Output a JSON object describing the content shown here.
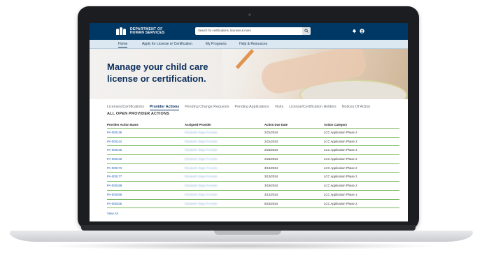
{
  "header": {
    "agency_line1": "DEPARTMENT OF",
    "agency_line2": "HUMAN SERVICES",
    "search_placeholder": "Search for certifications, licenses & more",
    "icons": [
      "search-icon",
      "bell-icon",
      "user-icon"
    ]
  },
  "nav": {
    "items": [
      "Home",
      "Apply for License or Certification",
      "My Programs",
      "Help & Resources"
    ]
  },
  "hero": {
    "title_line1": "Manage your child care",
    "title_line2": "license or certification."
  },
  "tabs": [
    "Licenses/Certifications",
    "Provider Actions",
    "Pending Change Requests",
    "Pending Applications",
    "Visits",
    "License/Certification Holders",
    "Notices Of Action"
  ],
  "active_tab": "Provider Actions",
  "section_title": "ALL OPEN PROVIDER ACTIONS",
  "table": {
    "headers": [
      "Provider Action Name",
      "Assigned Provider",
      "Action Due Date",
      "Action Category"
    ],
    "rows": [
      {
        "name": "PA-000136",
        "provider": "Elizabeth Slape Provider",
        "due": "2/21/2024",
        "category": "LCC Application Phase 2"
      },
      {
        "name": "PA-000142",
        "provider": "Elizabeth Slape Provider",
        "due": "2/21/2024",
        "category": "LCC Application Phase 2"
      },
      {
        "name": "PA-000145",
        "provider": "Elizabeth Slape Provider",
        "due": "2/23/2024",
        "category": "LCC Application Phase 2"
      },
      {
        "name": "PA-000146",
        "provider": "Elizabeth Slape Provider",
        "due": "2/23/2024",
        "category": "LCC Application Phase 2"
      },
      {
        "name": "PA-000173",
        "provider": "Elizabeth Slape Provider",
        "due": "3/13/2024",
        "category": "LCC Application Phase 2"
      },
      {
        "name": "PA-000177",
        "provider": "Elizabeth Slape Provider",
        "due": "3/13/2024",
        "category": "LCC Application Phase 2"
      },
      {
        "name": "PA-000189",
        "provider": "Elizabeth Slape Provider",
        "due": "3/19/2024",
        "category": "LCC Application Phase 2"
      },
      {
        "name": "PA-000296",
        "provider": "Elizabeth Slape Provider",
        "due": "4/12/2024",
        "category": "LCC Application Phase 1"
      },
      {
        "name": "PA-000335",
        "provider": "Elizabeth Slape Provider",
        "due": "5/16/2024",
        "category": "LCC Application Phase 2"
      }
    ]
  },
  "view_all": "View All",
  "colors": {
    "header_bg": "#003865",
    "nav_bg": "#dbe8f2",
    "title": "#0b2e5b",
    "link": "#1a5eb4",
    "row_divider": "#79b85f"
  }
}
